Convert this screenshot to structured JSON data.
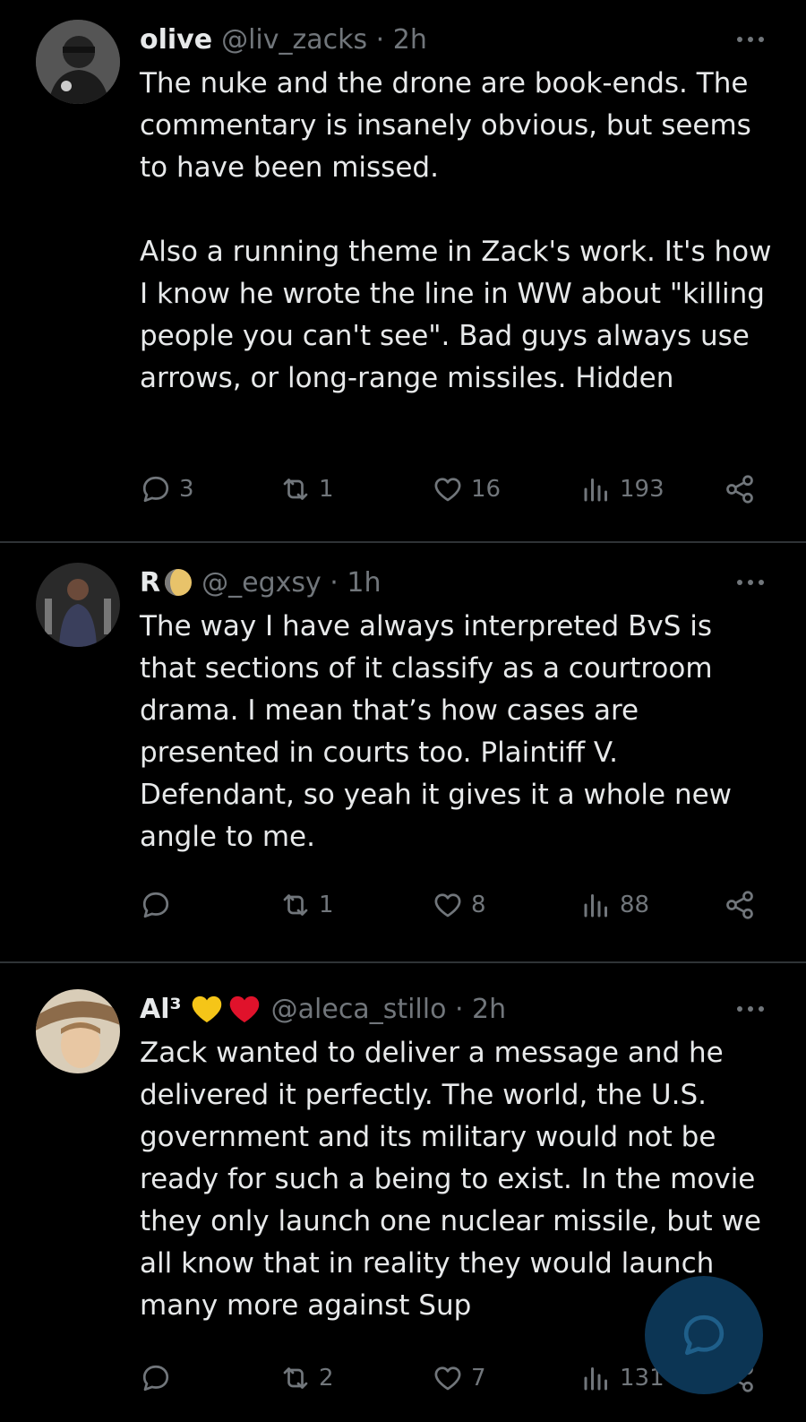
{
  "tweets": [
    {
      "name": "olive",
      "handle": "@liv_zacks · 2h",
      "emojis": [],
      "text": "The nuke and the drone are book-ends. The commentary is insanely obvious, but seems to have been missed.\n\nAlso a running theme in Zack's work. It's how I know he wrote the line in WW about \"killing people you can't see\". Bad guys always use arrows, or long-range missiles. Hidden",
      "replies": "3",
      "retweets": "1",
      "likes": "16",
      "views": "193"
    },
    {
      "name": "R",
      "handle": "@_egxsy · 1h",
      "emojis": [
        "moon-icon"
      ],
      "text": "The way I have always interpreted BvS is that sections of it classify as a courtroom drama. I mean that’s how cases are presented in courts too. Plaintiff V. Defendant, so yeah it gives it a whole new angle to me.",
      "replies": "",
      "retweets": "1",
      "likes": "8",
      "views": "88"
    },
    {
      "name": "Al³",
      "handle": "@aleca_stillo · 2h",
      "emojis": [
        "yellow-heart-icon",
        "red-heart-icon"
      ],
      "text": "Zack wanted to deliver a message and he delivered it perfectly. The world, the U.S. government and its military would not be ready for such a being to exist. In the movie they only launch one nuclear missile, but we all know that in reality they would launch many more against Sup",
      "replies": "",
      "retweets": "2",
      "likes": "7",
      "views": "131"
    }
  ],
  "icons": {
    "reply": "reply-icon",
    "retweet": "retweet-icon",
    "like": "heart-icon",
    "views": "views-icon",
    "share": "share-icon",
    "more": "more-options-icon",
    "compose": "compose-reply-icon"
  },
  "colors": {
    "background": "#000000",
    "text": "#e7e9ea",
    "muted": "#71767b",
    "divider": "#2f3336",
    "fab": "#0c3554"
  }
}
